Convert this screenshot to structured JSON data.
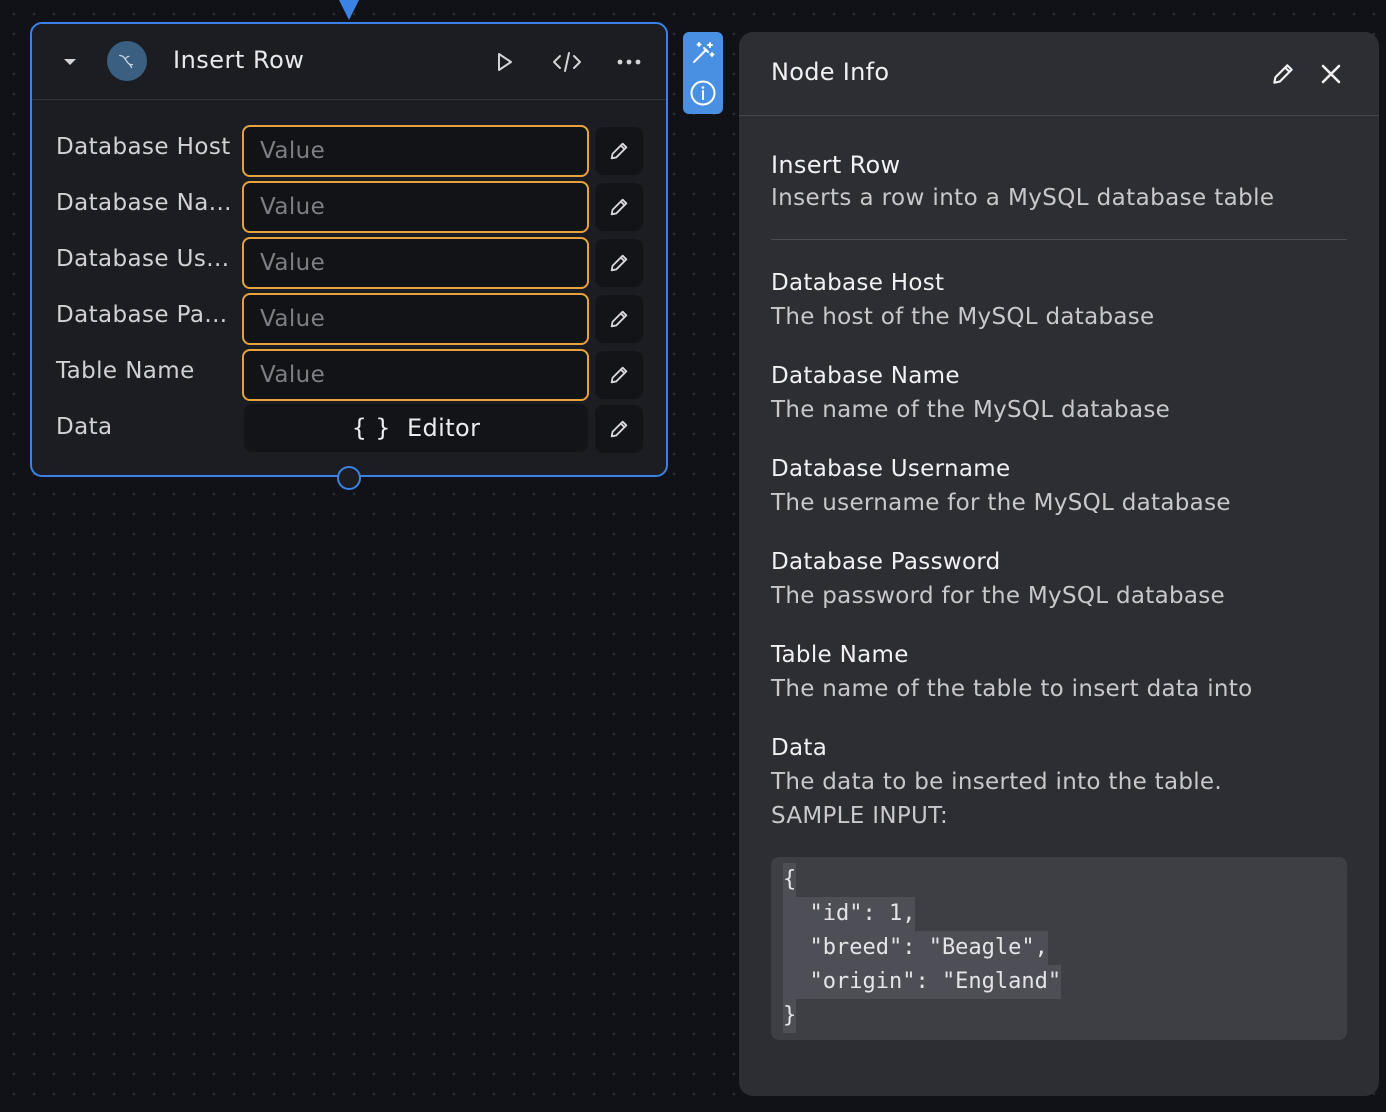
{
  "node": {
    "title": "Insert Row",
    "fields": [
      {
        "label": "Database Host",
        "placeholder": "Value"
      },
      {
        "label": "Database Na...",
        "placeholder": "Value"
      },
      {
        "label": "Database Us...",
        "placeholder": "Value"
      },
      {
        "label": "Database Pa...",
        "placeholder": "Value"
      },
      {
        "label": "Table Name",
        "placeholder": "Value"
      }
    ],
    "data_label": "Data",
    "editor_braces": "{ }",
    "editor_label": "Editor"
  },
  "panel": {
    "title": "Node Info",
    "node_name": "Insert Row",
    "node_description": "Inserts a row into a MySQL database table",
    "params": [
      {
        "name": "Database Host",
        "desc": "The host of the MySQL database"
      },
      {
        "name": "Database Name",
        "desc": "The name of the MySQL database"
      },
      {
        "name": "Database Username",
        "desc": "The username for the MySQL database"
      },
      {
        "name": "Database Password",
        "desc": "The password for the MySQL database"
      },
      {
        "name": "Table Name",
        "desc": "The name of the table to insert data into"
      },
      {
        "name": "Data",
        "desc": "The data to be inserted into the table.",
        "extra": "SAMPLE INPUT:"
      }
    ],
    "code_lines": [
      "{",
      "  \"id\": 1,",
      "  \"breed\": \"Beagle\",",
      "  \"origin\": \"England\"",
      "}"
    ]
  },
  "icons": {
    "collapse": "chevron-down-icon",
    "logo": "mysql-dolphin-icon",
    "run": "play-icon",
    "code": "code-icon",
    "more": "more-horizontal-icon",
    "edit": "pencil-icon",
    "magic": "magic-wand-icon",
    "info": "info-icon",
    "close": "close-icon"
  },
  "colors": {
    "accent": "#3b82e6",
    "input_border": "#e6a23c",
    "toolbar": "#4a90e2"
  }
}
